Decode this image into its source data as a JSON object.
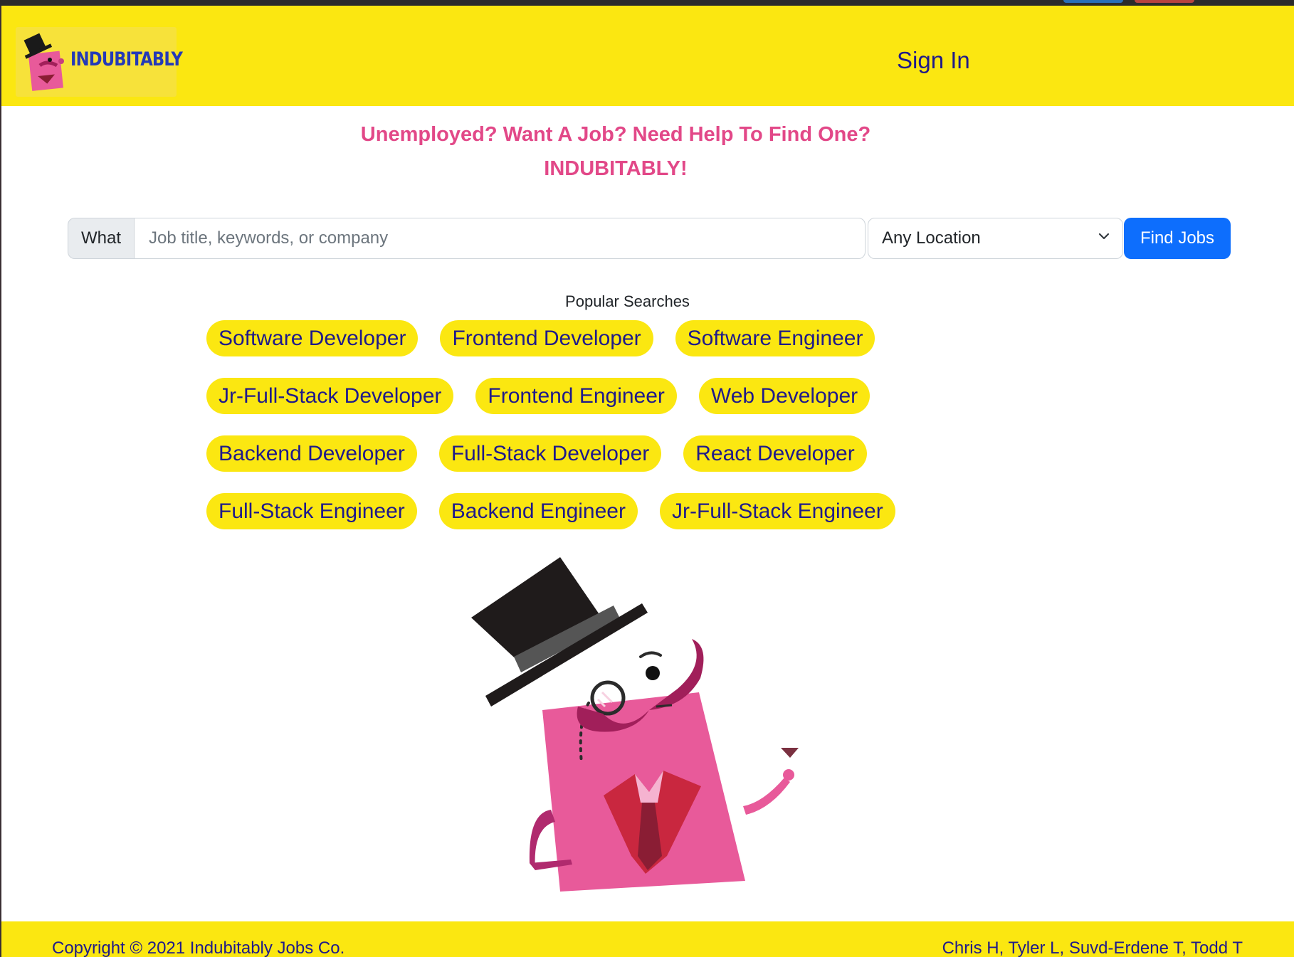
{
  "brand": {
    "name": "INDUBITABLY"
  },
  "nav": {
    "signin_label": "Sign In"
  },
  "headline": {
    "line1": "Unemployed? Want A Job? Need Help To Find One?",
    "line2": "INDUBITABLY!"
  },
  "search": {
    "what_label": "What",
    "what_placeholder": "Job title, keywords, or company",
    "what_value": "",
    "location_selected": "Any Location",
    "find_button": "Find Jobs"
  },
  "popular": {
    "title": "Popular Searches",
    "rows": [
      [
        "Software Developer",
        "Frontend Developer",
        "Software Engineer"
      ],
      [
        "Jr-Full-Stack Developer",
        "Frontend Engineer",
        "Web Developer"
      ],
      [
        "Backend Developer",
        "Full-Stack Developer",
        "React Developer"
      ],
      [
        "Full-Stack Engineer",
        "Backend Engineer",
        "Jr-Full-Stack Engineer"
      ]
    ]
  },
  "footer": {
    "copyright": "Copyright © 2021 Indubitably Jobs Co.",
    "authors": "Chris H, Tyler L, Suvd-Erdene T, Todd T"
  },
  "colors": {
    "accent_yellow": "#fbe711",
    "navy_text": "#1f1a8a",
    "headline_pink": "#e24888",
    "button_blue": "#0d6efd"
  },
  "icons": {
    "logo": "top-hat-mascot-logo",
    "location_dropdown": "chevron-down-icon",
    "mascot": "top-hat-mascot-illustration"
  }
}
